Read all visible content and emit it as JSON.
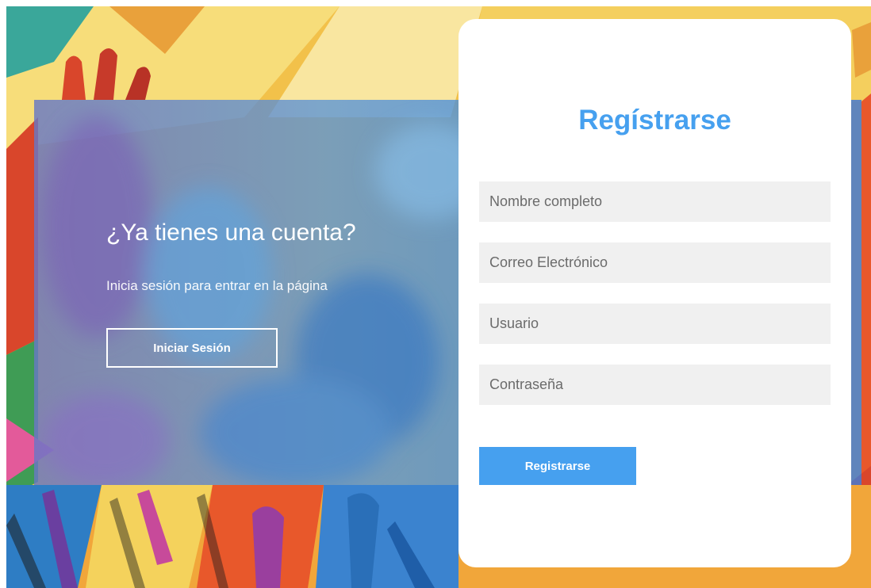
{
  "info": {
    "title": "¿Ya tienes una cuenta?",
    "text": "Inicia sesión para entrar en la página",
    "login_label": "Iniciar Sesión"
  },
  "form": {
    "title": "Regístrarse",
    "name_placeholder": "Nombre completo",
    "email_placeholder": "Correo Electrónico",
    "user_placeholder": "Usuario",
    "password_placeholder": "Contraseña",
    "register_label": "Registrarse"
  },
  "colors": {
    "accent": "#46a0ef",
    "panel_blue": "#5a94d6",
    "field_bg": "#f0f0f0"
  }
}
